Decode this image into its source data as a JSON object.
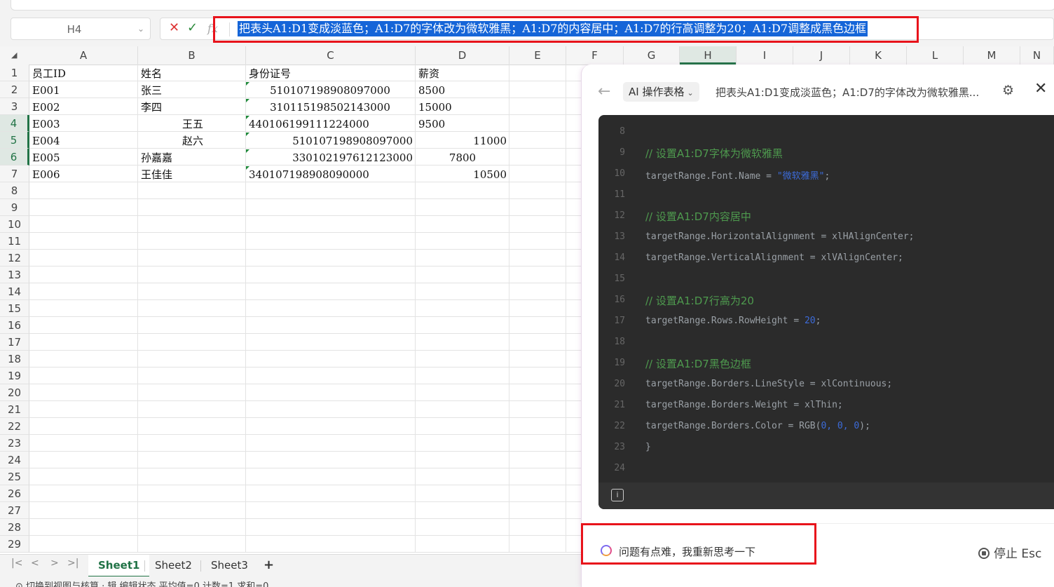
{
  "namebox": {
    "ref": "H4"
  },
  "formula": {
    "cancel": "✕",
    "confirm": "✓",
    "fx": "fx",
    "text": "把表头A1:D1变成淡蓝色；A1:D7的字体改为微软雅黑；A1:D7的内容居中；A1:D7的行高调整为20；A1:D7调整成黑色边框"
  },
  "columns": [
    "A",
    "B",
    "C",
    "D",
    "E",
    "F",
    "G",
    "H",
    "I",
    "J",
    "K",
    "L",
    "M",
    "N"
  ],
  "rows": [
    "1",
    "2",
    "3",
    "4",
    "5",
    "6",
    "7",
    "8",
    "9",
    "10",
    "11",
    "12",
    "13",
    "14",
    "15",
    "16",
    "17",
    "18",
    "19",
    "20",
    "21",
    "22",
    "23",
    "24",
    "25",
    "26",
    "27",
    "28",
    "29"
  ],
  "table": {
    "header": [
      "员工ID",
      "姓名",
      "身份证号",
      "薪资"
    ],
    "rows": [
      [
        "E001",
        "张三",
        "510107198908097000",
        "8500"
      ],
      [
        "E002",
        "李四",
        "310115198502143000",
        "15000"
      ],
      [
        "E003",
        "王五",
        "440106199111224000",
        "9500"
      ],
      [
        "E004",
        "赵六",
        "510107198908097000",
        "11000"
      ],
      [
        "E005",
        "孙嘉嘉",
        "330102197612123000",
        "7800"
      ],
      [
        "E006",
        "王佳佳",
        "340107198908090000",
        "10500"
      ]
    ]
  },
  "sheets": {
    "tabs": [
      "Sheet1",
      "Sheet2",
      "Sheet3"
    ],
    "add": "+"
  },
  "statusbar": {
    "text": "⊙ 切换到视图与核算 ·   辑 编辑状态   平均值=0   计数=1   求和=0"
  },
  "panel": {
    "back": "←",
    "mode": "AI 操作表格",
    "title": "把表头A1:D1变成淡蓝色；A1:D7的字体改为微软雅黑...",
    "gear": "⚙",
    "close": "✕",
    "code_lines": [
      {
        "n": "8",
        "t": ""
      },
      {
        "n": "9",
        "t": "// 设置A1:D7字体为微软雅黑"
      },
      {
        "n": "10",
        "t": "targetRange.Font.Name = "
      },
      {
        "n": "11",
        "t": ""
      },
      {
        "n": "12",
        "t": "// 设置A1:D7内容居中"
      },
      {
        "n": "13",
        "t": "targetRange.HorizontalAlignment = xlHAlignCenter;"
      },
      {
        "n": "14",
        "t": "targetRange.VerticalAlignment = xlVAlignCenter;"
      },
      {
        "n": "15",
        "t": ""
      },
      {
        "n": "16",
        "t": "// 设置A1:D7行高为20"
      },
      {
        "n": "17",
        "t": "targetRange.Rows.RowHeight = "
      },
      {
        "n": "18",
        "t": ""
      },
      {
        "n": "19",
        "t": "// 设置A1:D7黑色边框"
      },
      {
        "n": "20",
        "t": "targetRange.Borders.LineStyle = xlContinuous;"
      },
      {
        "n": "21",
        "t": "targetRange.Borders.Weight = xlThin;"
      },
      {
        "n": "22",
        "t": "targetRange.Borders.Color = RGB("
      },
      {
        "n": "23",
        "t": "}"
      },
      {
        "n": "24",
        "t": ""
      }
    ],
    "font_string": "\"微软雅黑\"",
    "row_height_value": "20",
    "rgb_args": "0, 0, 0",
    "thinking": "问题有点难，我重新思考一下",
    "stop": "停止 Esc"
  },
  "colors": {
    "accent": "#217346",
    "highlight_red": "#e8131b",
    "selection_blue": "#1565d8"
  }
}
